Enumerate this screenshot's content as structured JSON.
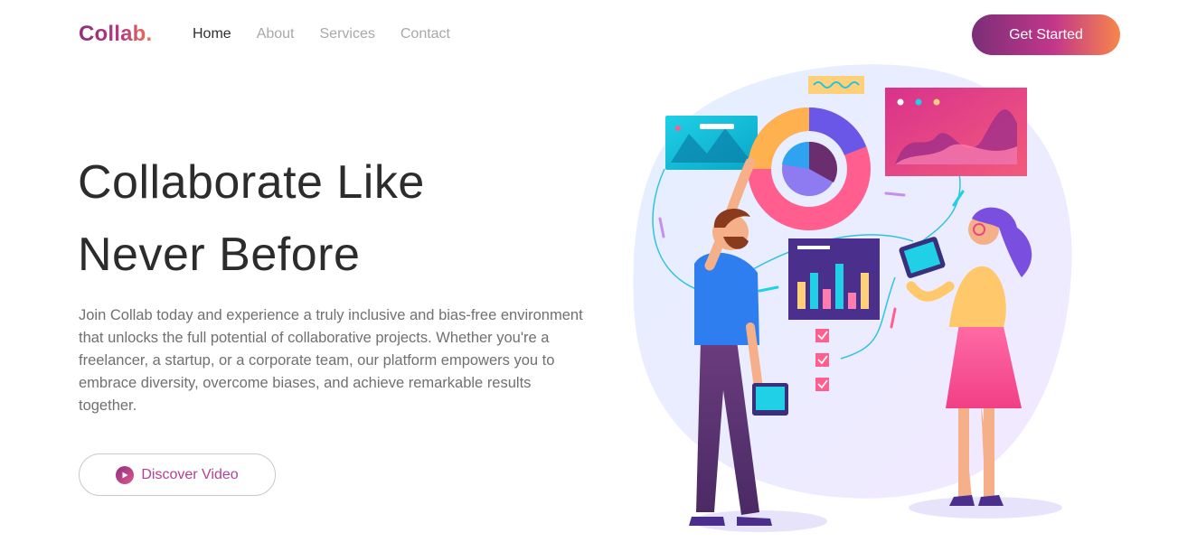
{
  "brand": {
    "logo_text": "Collab."
  },
  "nav": {
    "items": [
      {
        "label": "Home",
        "active": true
      },
      {
        "label": "About",
        "active": false
      },
      {
        "label": "Services",
        "active": false
      },
      {
        "label": "Contact",
        "active": false
      }
    ]
  },
  "header": {
    "cta_label": "Get Started"
  },
  "hero": {
    "title_line1": "Collaborate Like",
    "title_line2": "Never Before",
    "description": "Join Collab today and experience a truly inclusive and bias-free environment that unlocks the full potential of collaborative projects. Whether you're a freelancer, a startup, or a corporate team, our platform empowers you to embrace diversity, overcome biases, and achieve remarkable results together.",
    "video_button_label": "Discover Video",
    "video_icon": "play-icon"
  },
  "colors": {
    "brand_purple": "#8e2f7d",
    "brand_pink": "#c2368a",
    "brand_orange": "#f7864b",
    "text_dark": "#2c2c2c",
    "text_muted": "#707070",
    "nav_inactive": "#a8a8a8"
  }
}
